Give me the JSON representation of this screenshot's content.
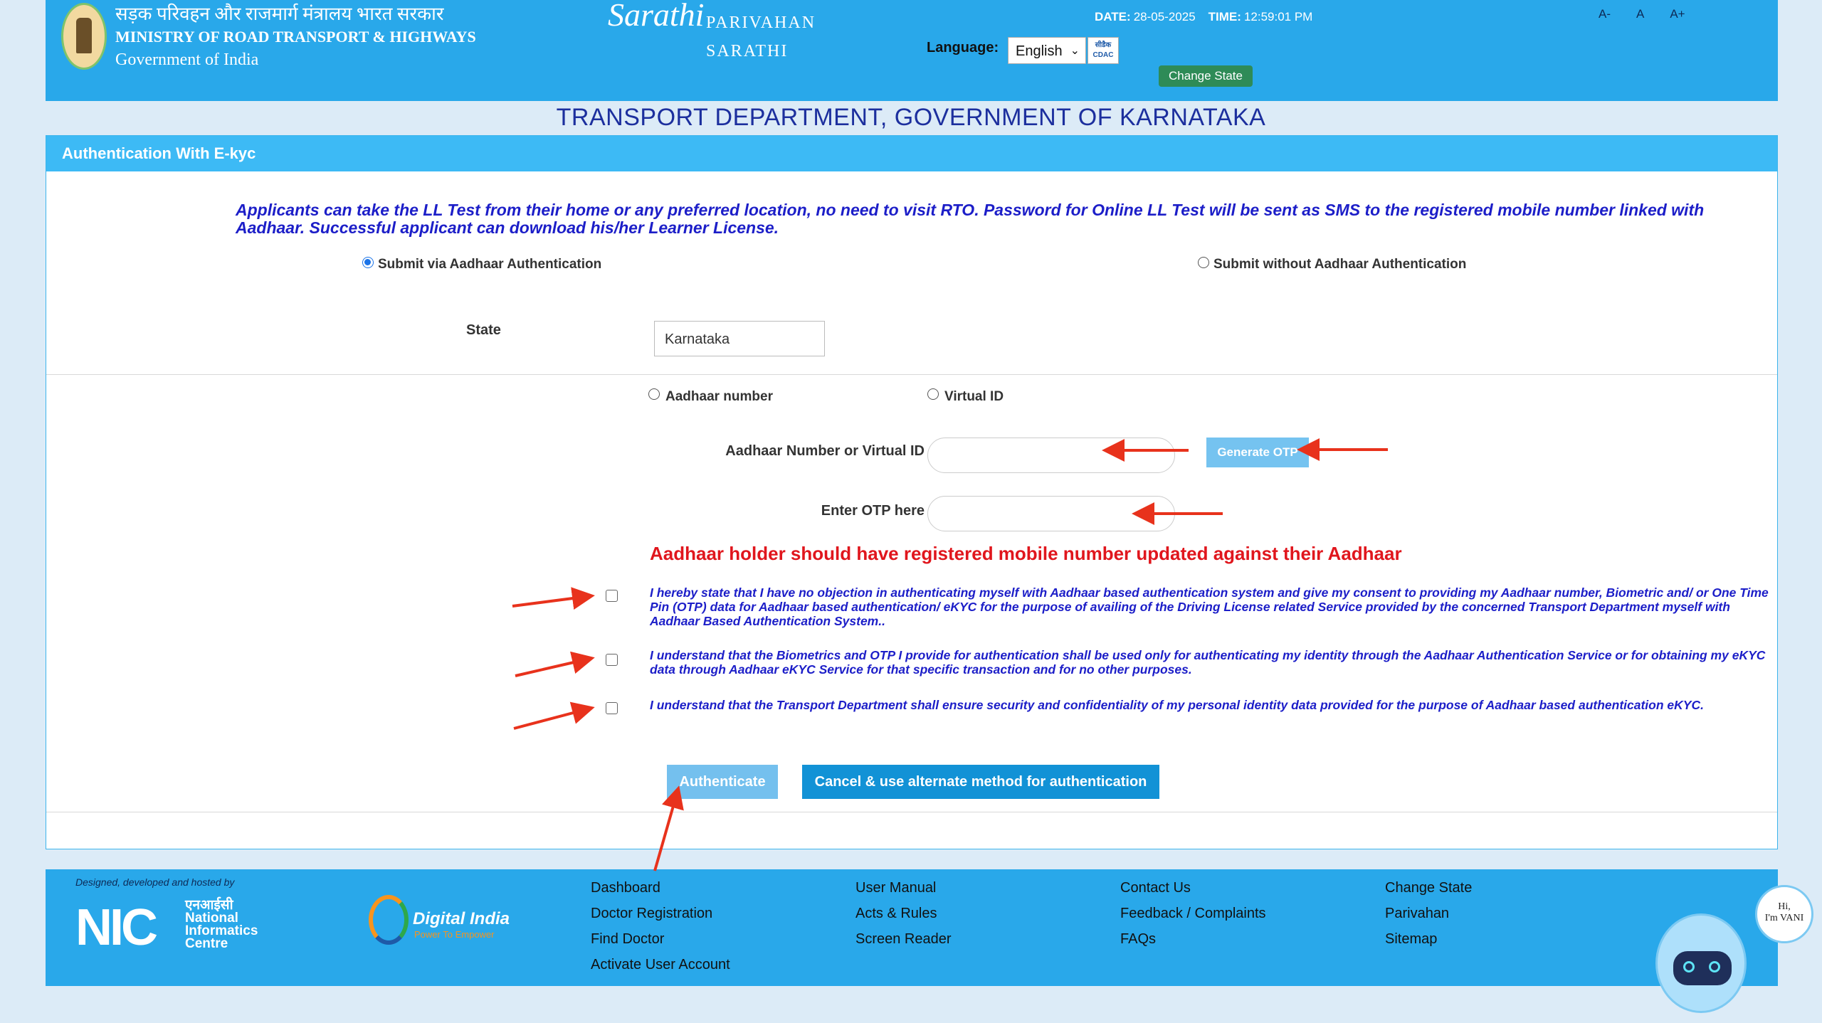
{
  "header": {
    "ministry_hindi": "सड़क परिवहन और राजमार्ग मंत्रालय भारत सरकार",
    "ministry_english": "MINISTRY OF ROAD TRANSPORT & HIGHWAYS",
    "government": "Government of India",
    "sarathi_logo": "Sarathi",
    "parivahan": "PARIVAHAN",
    "sarathi": "SARATHI",
    "date_label": "DATE:",
    "date_value": "28-05-2025",
    "time_label": "TIME:",
    "time_value": "12:59:01 PM",
    "language_label": "Language:",
    "language_value": "English",
    "cdac_label": "सीडैक CDAC",
    "change_state": "Change State",
    "font_small": "A-",
    "font_normal": "A",
    "font_large": "A+"
  },
  "dept_title": "TRANSPORT DEPARTMENT, GOVERNMENT OF KARNATAKA",
  "panel": {
    "heading": "Authentication With E-kyc",
    "notice": "Applicants can take the LL Test from their home or any preferred location, no need to visit RTO. Password for Online LL Test will be sent as SMS to the registered mobile number linked with Aadhaar. Successful applicant can download his/her Learner License.",
    "submit_via_aadhaar": "Submit via Aadhaar Authentication",
    "submit_without_aadhaar": "Submit without Aadhaar Authentication",
    "state_label": "State",
    "state_value": "Karnataka",
    "aadhaar_number_option": "Aadhaar number",
    "virtual_id_option": "Virtual ID",
    "aadhaar_field_label": "Aadhaar Number or Virtual ID",
    "generate_otp": "Generate OTP",
    "otp_label": "Enter OTP here",
    "warning": "Aadhaar holder should have registered mobile number updated against their Aadhaar",
    "consent_1": "I hereby state that I have no objection in authenticating myself with Aadhaar based authentication system and give my consent to providing my Aadhaar number, Biometric and/ or One Time Pin (OTP) data for Aadhaar based authentication/ eKYC for the purpose of availing of the Driving License related Service provided by the concerned Transport Department myself with Aadhaar Based Authentication System..",
    "consent_2": "I understand that the Biometrics and OTP I provide for authentication shall be used only for authenticating my identity through the Aadhaar Authentication Service or for obtaining my eKYC data through Aadhaar eKYC Service for that specific transaction and for no other purposes.",
    "consent_3": "I understand that the Transport Department shall ensure security and confidentiality of my personal identity data provided for the purpose of Aadhaar based authentication eKYC.",
    "authenticate": "Authenticate",
    "cancel": "Cancel & use alternate method for authentication"
  },
  "footer": {
    "designed_by": "Designed, developed and hosted by",
    "nic_logo": "NIC",
    "nic_hindi": "एनआईसी",
    "nic_l1": "National",
    "nic_l2": "Informatics",
    "nic_l3": "Centre",
    "digital_india": "Digital India",
    "digital_india_tag": "Power To Empower",
    "col1": [
      "Dashboard",
      "Doctor Registration",
      "Find Doctor",
      "Activate User Account"
    ],
    "col2": [
      "User Manual",
      "Acts & Rules",
      "Screen Reader"
    ],
    "col3": [
      "Contact Us",
      "Feedback / Complaints",
      "FAQs"
    ],
    "col4": [
      "Change State",
      "Parivahan",
      "Sitemap"
    ]
  },
  "vani": {
    "line1": "Hi,",
    "line2": "I'm VANI"
  },
  "colors": {
    "header_blue": "#29a8ea",
    "title_blue": "#1c2f9e",
    "notice_blue": "#1c1ec8",
    "warning_red": "#e0161d",
    "cancel_blue": "#1292d6",
    "change_state_green": "#2e8b57",
    "arrow_red": "#e8321c"
  },
  "icons": [
    "national-emblem-icon",
    "chevron-down-icon",
    "robot-icon",
    "arrow-annotation-icon"
  ]
}
